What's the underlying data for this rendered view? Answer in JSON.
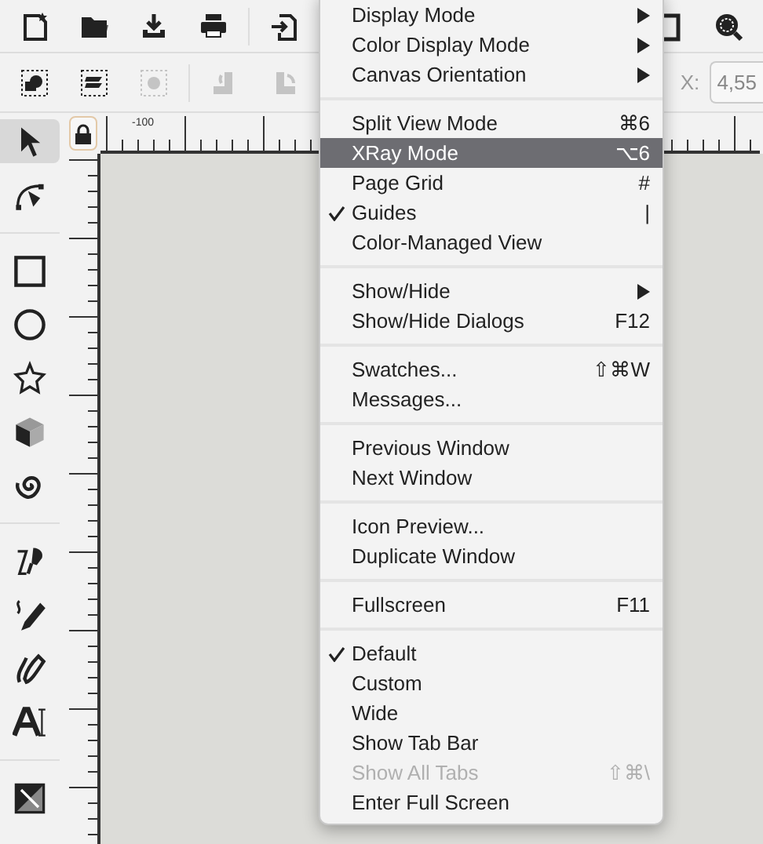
{
  "toolbar": {
    "row_1": [
      {
        "items": [
          {
            "kind": "new",
            "disabled": false
          },
          {
            "kind": "open",
            "disabled": false
          },
          {
            "kind": "save",
            "disabled": false
          },
          {
            "kind": "print",
            "disabled": false
          }
        ]
      },
      {
        "items": [
          {
            "kind": "import",
            "disabled": false
          }
        ]
      },
      {
        "items": [
          {
            "kind": "document",
            "disabled": false
          },
          {
            "kind": "zoom",
            "disabled": false
          }
        ]
      }
    ],
    "row_2": [
      {
        "items": [
          {
            "kind": "select-all",
            "disabled": false
          },
          {
            "kind": "select-layers",
            "disabled": false
          },
          {
            "kind": "select-same",
            "disabled": true
          }
        ]
      },
      {
        "items": [
          {
            "kind": "rotate-left",
            "disabled": true
          },
          {
            "kind": "rotate-right",
            "disabled": true
          }
        ]
      }
    ],
    "coordinate_label": "X:",
    "coordinate_value": "4,55"
  },
  "ruler": {
    "top_label": "-100"
  },
  "tool_groups": [
    {
      "tools": [
        {
          "kind": "select",
          "selected": true
        },
        {
          "kind": "node",
          "selected": false
        }
      ]
    },
    {
      "tools": [
        {
          "kind": "rect",
          "selected": false
        },
        {
          "kind": "circle",
          "selected": false
        },
        {
          "kind": "star",
          "selected": false
        },
        {
          "kind": "box3d",
          "selected": false
        },
        {
          "kind": "spiral",
          "selected": false
        }
      ]
    },
    {
      "tools": [
        {
          "kind": "bezier",
          "selected": false
        },
        {
          "kind": "pencil",
          "selected": false
        },
        {
          "kind": "calligraphy",
          "selected": false
        },
        {
          "kind": "text",
          "selected": false
        }
      ]
    },
    {
      "tools": [
        {
          "kind": "gradient",
          "selected": false
        }
      ]
    }
  ],
  "menu": {
    "sections": [
      {
        "items": [
          {
            "label": "Display Mode",
            "submenu": true,
            "checked": false,
            "selected": false,
            "disabled": false
          },
          {
            "label": "Color Display Mode",
            "submenu": true,
            "checked": false,
            "selected": false,
            "disabled": false
          },
          {
            "label": "Canvas Orientation",
            "submenu": true,
            "checked": false,
            "selected": false,
            "disabled": false
          }
        ]
      },
      {
        "items": [
          {
            "label": "Split View Mode",
            "shortcut": "⌘6",
            "submenu": false,
            "checked": false,
            "selected": false,
            "disabled": false
          },
          {
            "label": "XRay Mode",
            "shortcut": "⌥6",
            "submenu": false,
            "checked": false,
            "selected": true,
            "disabled": false
          },
          {
            "label": "Page Grid",
            "shortcut": "#",
            "submenu": false,
            "checked": false,
            "selected": false,
            "disabled": false
          },
          {
            "label": "Guides",
            "shortcut": "|",
            "submenu": false,
            "checked": true,
            "selected": false,
            "disabled": false
          },
          {
            "label": "Color-Managed View",
            "submenu": false,
            "checked": false,
            "selected": false,
            "disabled": false
          }
        ]
      },
      {
        "items": [
          {
            "label": "Show/Hide",
            "submenu": true,
            "checked": false,
            "selected": false,
            "disabled": false
          },
          {
            "label": "Show/Hide Dialogs",
            "shortcut": "F12",
            "submenu": false,
            "checked": false,
            "selected": false,
            "disabled": false
          }
        ]
      },
      {
        "items": [
          {
            "label": "Swatches...",
            "shortcut": "⇧⌘W",
            "submenu": false,
            "checked": false,
            "selected": false,
            "disabled": false
          },
          {
            "label": "Messages...",
            "submenu": false,
            "checked": false,
            "selected": false,
            "disabled": false
          }
        ]
      },
      {
        "items": [
          {
            "label": "Previous Window",
            "submenu": false,
            "checked": false,
            "selected": false,
            "disabled": false
          },
          {
            "label": "Next Window",
            "submenu": false,
            "checked": false,
            "selected": false,
            "disabled": false
          }
        ]
      },
      {
        "items": [
          {
            "label": "Icon Preview...",
            "submenu": false,
            "checked": false,
            "selected": false,
            "disabled": false
          },
          {
            "label": "Duplicate Window",
            "submenu": false,
            "checked": false,
            "selected": false,
            "disabled": false
          }
        ]
      },
      {
        "items": [
          {
            "label": "Fullscreen",
            "shortcut": "F11",
            "submenu": false,
            "checked": false,
            "selected": false,
            "disabled": false
          }
        ]
      },
      {
        "items": [
          {
            "label": "Default",
            "submenu": false,
            "checked": true,
            "selected": false,
            "disabled": false
          },
          {
            "label": "Custom",
            "submenu": false,
            "checked": false,
            "selected": false,
            "disabled": false
          },
          {
            "label": "Wide",
            "submenu": false,
            "checked": false,
            "selected": false,
            "disabled": false
          },
          {
            "label": "Show Tab Bar",
            "submenu": false,
            "checked": false,
            "selected": false,
            "disabled": false
          },
          {
            "label": "Show All Tabs",
            "shortcut": "⇧⌘\\",
            "submenu": false,
            "checked": false,
            "selected": false,
            "disabled": true
          },
          {
            "label": "Enter Full Screen",
            "submenu": false,
            "checked": false,
            "selected": false,
            "disabled": false
          }
        ]
      }
    ]
  }
}
